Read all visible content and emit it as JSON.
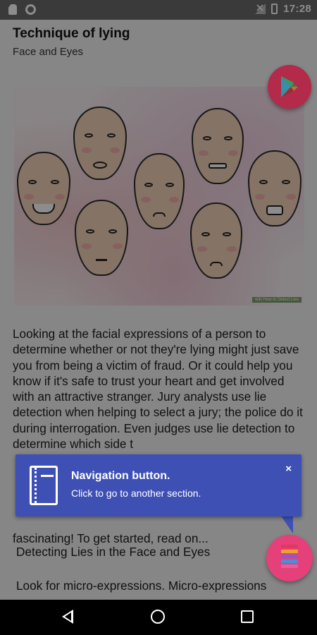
{
  "status_bar": {
    "left_icons": [
      "sd-card-icon",
      "circle-icon"
    ],
    "right_icons": [
      "signal-icon",
      "battery-icon"
    ],
    "time": "17:28"
  },
  "page": {
    "title": "Technique of lying",
    "subtitle": "Face and Eyes"
  },
  "illustration": {
    "watermark": "wiki How to Detect Lies"
  },
  "article": {
    "paragraph": "Looking at the facial expressions of a person to determine whether or not they're lying might just save you from being a victim of fraud. Or it could help you know if it's safe to trust your heart and get involved with an attractive stranger. Jury analysts use lie detection when helping to select a jury; the police do it during interrogation. Even judges use lie detection to determine which side t",
    "paragraph_end": "fascinating! To get started, read on...",
    "section_heading": "Detecting Lies in the Face and Eyes",
    "paragraph2": "Look for micro-expressions. Micro-expressions"
  },
  "tooltip": {
    "title": "Navigation button.",
    "body": "Click to go to another section.",
    "close": "×",
    "icon": "notebook-icon"
  },
  "fab": {
    "play_icon": "play-store-icon",
    "nav_icon": "menu-bars-icon",
    "nav_bar_colors": [
      "#e03a5a",
      "#f0a030",
      "#8a5cc8",
      "#4a8fd8",
      "#e060a0"
    ]
  },
  "colors": {
    "tooltip": "#3f50b5",
    "fab_nav": "#e5407a",
    "fab_play": "#b32a4b"
  },
  "nav_bar": {
    "buttons": [
      "back-icon",
      "home-icon",
      "recent-apps-icon"
    ]
  }
}
